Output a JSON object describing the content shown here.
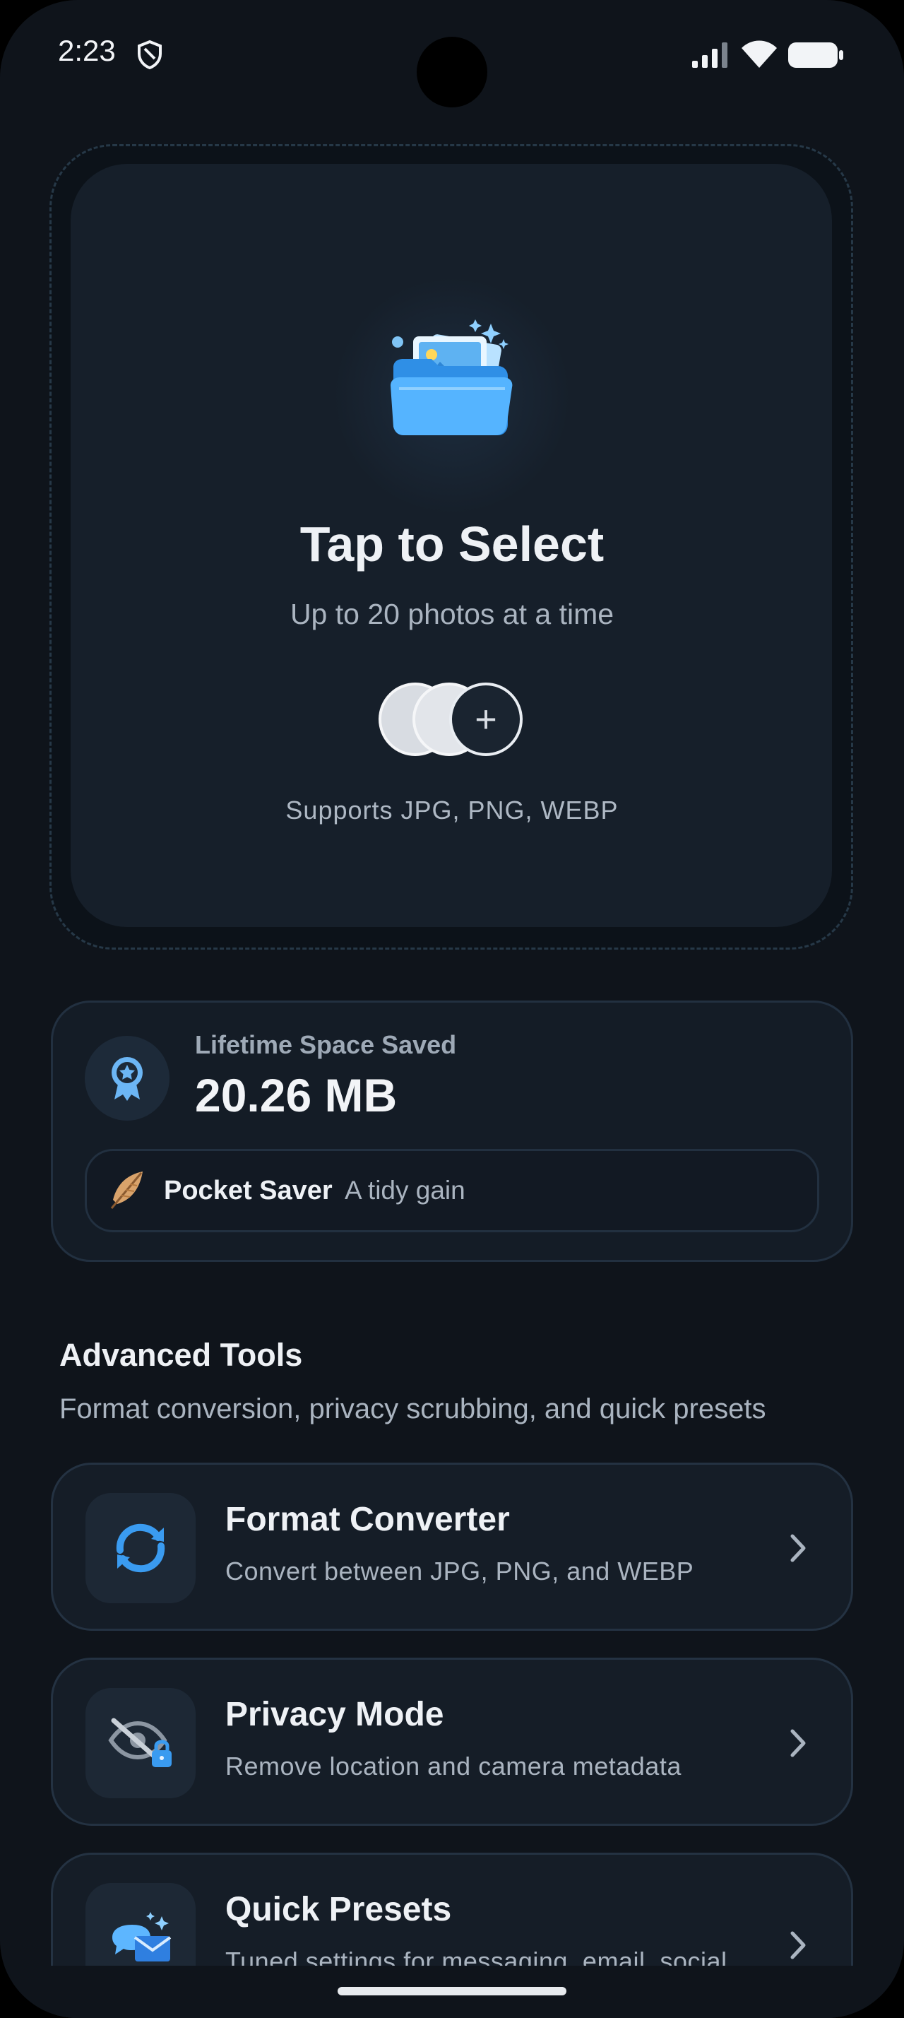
{
  "status_bar": {
    "time": "2:23",
    "icons": [
      "shield-icon",
      "cellular-signal-icon",
      "wifi-icon",
      "battery-icon"
    ]
  },
  "picker": {
    "title": "Tap to Select",
    "subtitle": "Up to 20 photos at a time",
    "formats": "Supports JPG, PNG, WEBP",
    "add_symbol": "+",
    "icon": "photo-folder-icon"
  },
  "savings": {
    "label": "Lifetime Space Saved",
    "value": "20.26 MB",
    "rank_name": "Pocket Saver",
    "rank_desc": "A tidy gain",
    "icon": "award-ribbon-icon"
  },
  "advanced": {
    "title": "Advanced Tools",
    "subtitle": "Format conversion, privacy scrubbing, and quick presets",
    "tools": [
      {
        "title": "Format Converter",
        "desc": "Convert between JPG, PNG, and WEBP",
        "icon": "refresh-arrows-icon"
      },
      {
        "title": "Privacy Mode",
        "desc": "Remove location and camera metadata",
        "icon": "hidden-eye-lock-icon"
      },
      {
        "title": "Quick Presets",
        "desc": "Tuned settings for messaging, email, social,",
        "icon": "chat-mail-icon"
      }
    ]
  },
  "colors": {
    "background": "#0f141b",
    "card": "#151d27",
    "accent": "#3a9bf0"
  }
}
